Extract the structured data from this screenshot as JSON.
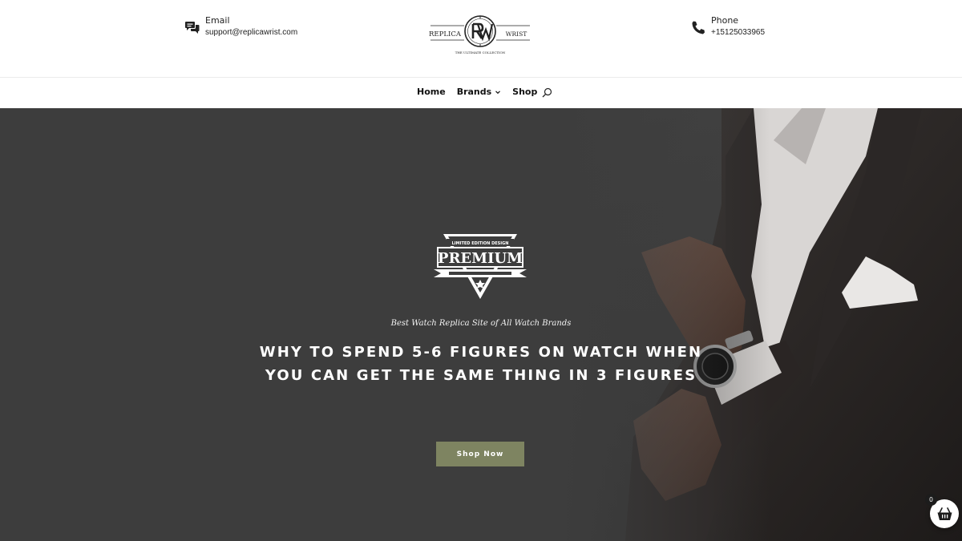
{
  "header": {
    "email": {
      "label": "Email",
      "value": "support@replicawrist.com",
      "icon": "chat-bubbles-icon"
    },
    "phone": {
      "label": "Phone",
      "value": "+15125033965",
      "icon": "phone-icon"
    },
    "logo": {
      "left_text": "REPLICA",
      "right_text": "WRIST",
      "monogram": "RW",
      "tagline": "THE ULTIMATE COLLECTION"
    }
  },
  "nav": {
    "items": [
      {
        "label": "Home"
      },
      {
        "label": "Brands",
        "has_dropdown": true
      },
      {
        "label": "Shop"
      }
    ],
    "search_icon": "search-icon"
  },
  "hero": {
    "badge": {
      "top_text": "LIMITED EDITION DESIGN",
      "main_text": "PREMIUM",
      "icon": "star-icon"
    },
    "tagline": "Best Watch Replica Site of All Watch Brands",
    "headline_line1": "WHY TO SPEND 5-6 FIGURES ON WATCH WHEN",
    "headline_line2": "YOU CAN GET THE SAME THING IN 3 FIGURES",
    "cta_label": "Shop Now"
  },
  "cart": {
    "count": "0",
    "icon": "basket-icon"
  },
  "colors": {
    "accent": "#7e8461",
    "hero_background": "#3d3d3d",
    "text_dark": "#111111"
  }
}
